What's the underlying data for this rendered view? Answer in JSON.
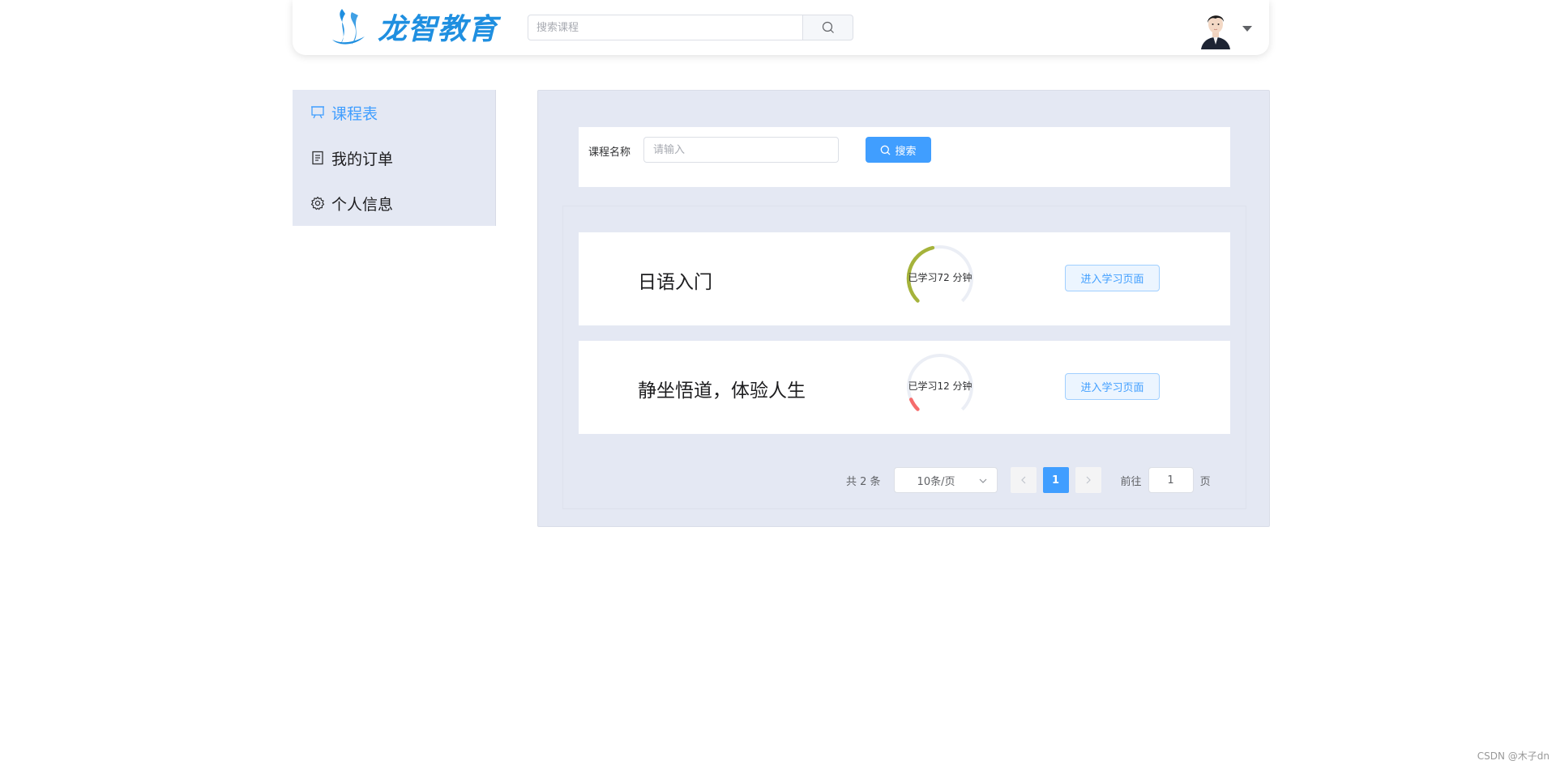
{
  "header": {
    "logo_text": "龙智教育",
    "search_placeholder": "搜索课程",
    "brand_color": "#1f8fe0"
  },
  "sidebar": {
    "items": [
      {
        "label": "课程表",
        "icon": "presentation-board-icon",
        "active": true
      },
      {
        "label": "我的订单",
        "icon": "document-icon",
        "active": false
      },
      {
        "label": "个人信息",
        "icon": "gear-icon",
        "active": false
      }
    ]
  },
  "filter": {
    "label": "课程名称",
    "input_placeholder": "请输入",
    "search_button": "搜索"
  },
  "courses": [
    {
      "name": "日语入门",
      "progress_text": "已学习72 分钟",
      "progress_fraction": 0.45,
      "progress_color": "#a5b33b",
      "action": "进入学习页面"
    },
    {
      "name": "静坐悟道，体验人生",
      "progress_text": "已学习12 分钟",
      "progress_fraction": 0.08,
      "progress_color": "#f56c6c",
      "action": "进入学习页面"
    }
  ],
  "pagination": {
    "total_text": "共 2 条",
    "page_size": "10条/页",
    "current_page": "1",
    "goto_label": "前往",
    "goto_value": "1",
    "page_suffix": "页"
  },
  "watermark": "CSDN @木子dn",
  "colors": {
    "accent": "#409eff",
    "panel_bg": "#e4e8f3"
  }
}
